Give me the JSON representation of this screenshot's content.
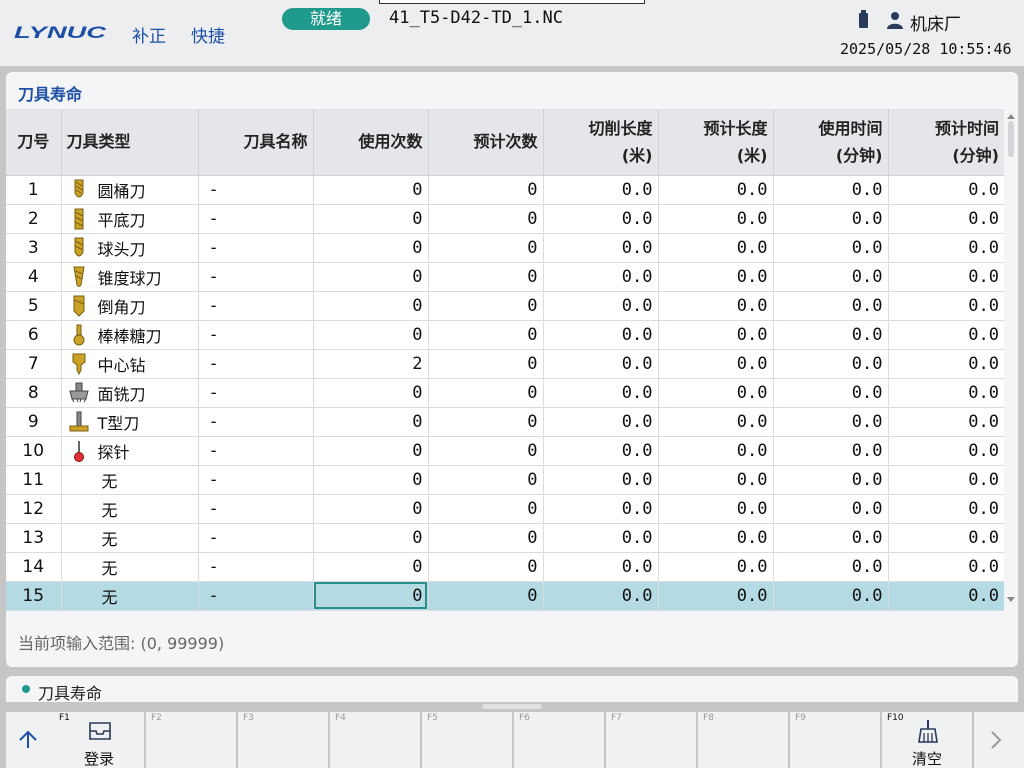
{
  "header": {
    "logo": "LYNUC",
    "menu": [
      "补正",
      "快捷"
    ],
    "status": "就绪",
    "program": "41_T5-D42-TD_1.NC",
    "user": "机床厂",
    "datetime": "2025/05/28 10:55:46"
  },
  "panel": {
    "title": "刀具寿命",
    "hint": "当前项输入范围: (0, 99999)"
  },
  "table": {
    "headers": [
      "刀号",
      "刀具类型",
      "刀具名称",
      "使用次数",
      "预计次数",
      "切削长度\n(米)",
      "预计长度\n(米)",
      "使用时间\n(分钟)",
      "预计时间\n(分钟)"
    ],
    "rows": [
      {
        "no": "1",
        "icon": "barrel-cutter-icon",
        "type": "圆桶刀",
        "name": "-",
        "used": "0",
        "plan": "0",
        "cut_len": "0.0",
        "plan_len": "0.0",
        "used_time": "0.0",
        "plan_time": "0.0"
      },
      {
        "no": "2",
        "icon": "flat-end-mill-icon",
        "type": "平底刀",
        "name": "-",
        "used": "0",
        "plan": "0",
        "cut_len": "0.0",
        "plan_len": "0.0",
        "used_time": "0.0",
        "plan_time": "0.0"
      },
      {
        "no": "3",
        "icon": "ball-end-mill-icon",
        "type": "球头刀",
        "name": "-",
        "used": "0",
        "plan": "0",
        "cut_len": "0.0",
        "plan_len": "0.0",
        "used_time": "0.0",
        "plan_time": "0.0"
      },
      {
        "no": "4",
        "icon": "tapered-ball-mill-icon",
        "type": "锥度球刀",
        "name": "-",
        "used": "0",
        "plan": "0",
        "cut_len": "0.0",
        "plan_len": "0.0",
        "used_time": "0.0",
        "plan_time": "0.0"
      },
      {
        "no": "5",
        "icon": "chamfer-cutter-icon",
        "type": "倒角刀",
        "name": "-",
        "used": "0",
        "plan": "0",
        "cut_len": "0.0",
        "plan_len": "0.0",
        "used_time": "0.0",
        "plan_time": "0.0"
      },
      {
        "no": "6",
        "icon": "lollipop-cutter-icon",
        "type": "棒棒糖刀",
        "name": "-",
        "used": "0",
        "plan": "0",
        "cut_len": "0.0",
        "plan_len": "0.0",
        "used_time": "0.0",
        "plan_time": "0.0"
      },
      {
        "no": "7",
        "icon": "center-drill-icon",
        "type": "中心钻",
        "name": "-",
        "used": "2",
        "plan": "0",
        "cut_len": "0.0",
        "plan_len": "0.0",
        "used_time": "0.0",
        "plan_time": "0.0"
      },
      {
        "no": "8",
        "icon": "face-mill-icon",
        "type": "面铣刀",
        "name": "-",
        "used": "0",
        "plan": "0",
        "cut_len": "0.0",
        "plan_len": "0.0",
        "used_time": "0.0",
        "plan_time": "0.0"
      },
      {
        "no": "9",
        "icon": "t-slot-cutter-icon",
        "type": "T型刀",
        "name": "-",
        "used": "0",
        "plan": "0",
        "cut_len": "0.0",
        "plan_len": "0.0",
        "used_time": "0.0",
        "plan_time": "0.0"
      },
      {
        "no": "10",
        "icon": "probe-icon",
        "type": "探针",
        "name": "-",
        "used": "0",
        "plan": "0",
        "cut_len": "0.0",
        "plan_len": "0.0",
        "used_time": "0.0",
        "plan_time": "0.0"
      },
      {
        "no": "11",
        "icon": "",
        "type": "无",
        "name": "-",
        "used": "0",
        "plan": "0",
        "cut_len": "0.0",
        "plan_len": "0.0",
        "used_time": "0.0",
        "plan_time": "0.0"
      },
      {
        "no": "12",
        "icon": "",
        "type": "无",
        "name": "-",
        "used": "0",
        "plan": "0",
        "cut_len": "0.0",
        "plan_len": "0.0",
        "used_time": "0.0",
        "plan_time": "0.0"
      },
      {
        "no": "13",
        "icon": "",
        "type": "无",
        "name": "-",
        "used": "0",
        "plan": "0",
        "cut_len": "0.0",
        "plan_len": "0.0",
        "used_time": "0.0",
        "plan_time": "0.0"
      },
      {
        "no": "14",
        "icon": "",
        "type": "无",
        "name": "-",
        "used": "0",
        "plan": "0",
        "cut_len": "0.0",
        "plan_len": "0.0",
        "used_time": "0.0",
        "plan_time": "0.0"
      },
      {
        "no": "15",
        "icon": "",
        "type": "无",
        "name": "-",
        "used": "0",
        "plan": "0",
        "cut_len": "0.0",
        "plan_len": "0.0",
        "used_time": "0.0",
        "plan_time": "0.0"
      }
    ],
    "selected_row": 15
  },
  "status_bar": {
    "label": "刀具寿命"
  },
  "softkeys": [
    {
      "key": "F1",
      "label": "登录",
      "icon": "inbox-icon"
    },
    {
      "key": "F2",
      "label": "",
      "icon": ""
    },
    {
      "key": "F3",
      "label": "",
      "icon": ""
    },
    {
      "key": "F4",
      "label": "",
      "icon": ""
    },
    {
      "key": "F5",
      "label": "",
      "icon": ""
    },
    {
      "key": "F6",
      "label": "",
      "icon": ""
    },
    {
      "key": "F7",
      "label": "",
      "icon": ""
    },
    {
      "key": "F8",
      "label": "",
      "icon": ""
    },
    {
      "key": "F9",
      "label": "",
      "icon": ""
    },
    {
      "key": "F10",
      "label": "清空",
      "icon": "broom-icon"
    }
  ],
  "colors": {
    "accent": "#1e4fa6",
    "status_green": "#1f9a8c",
    "selected_row": "#b4dbe4",
    "tool_gold": "#c9a227"
  }
}
